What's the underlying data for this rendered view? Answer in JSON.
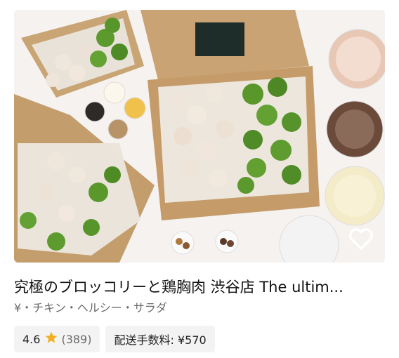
{
  "store": {
    "name": "究極のブロッコリーと鶏胸肉 渋谷店 The ultim...",
    "meta": "¥・チキン・ヘルシー・サラダ",
    "rating": "4.6",
    "review_count": "(389)",
    "delivery_fee": "配送手数料: ¥570"
  },
  "icons": {
    "favorite": "heart-icon",
    "rating": "star-icon"
  },
  "colors": {
    "star": "#f2b01e",
    "chip_bg": "#f3f3f3",
    "title_text": "#111111",
    "meta_text": "#6b6b6b"
  }
}
